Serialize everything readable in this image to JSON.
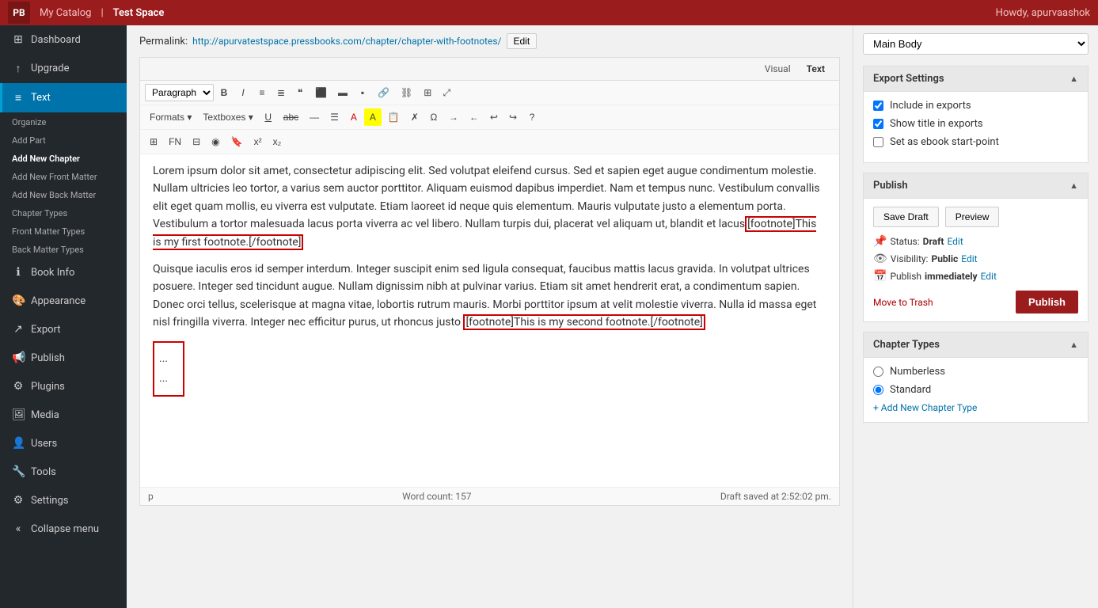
{
  "topbar": {
    "logo": "PB",
    "catalog_label": "My Catalog",
    "testspace_label": "Test Space",
    "howdy": "Howdy, apurvaashok"
  },
  "sidebar": {
    "items": [
      {
        "id": "dashboard",
        "label": "Dashboard",
        "icon": "⊞"
      },
      {
        "id": "upgrade",
        "label": "Upgrade",
        "icon": "↑"
      },
      {
        "id": "text",
        "label": "Text",
        "icon": "≡",
        "active": true
      },
      {
        "id": "organize",
        "label": "Organize",
        "icon": ""
      },
      {
        "id": "add-part",
        "label": "Add Part",
        "icon": ""
      },
      {
        "id": "add-new-chapter",
        "label": "Add New Chapter",
        "icon": ""
      },
      {
        "id": "add-front-matter",
        "label": "Add New Front Matter",
        "icon": ""
      },
      {
        "id": "add-back-matter",
        "label": "Add New Back Matter",
        "icon": ""
      },
      {
        "id": "chapter-types",
        "label": "Chapter Types",
        "icon": ""
      },
      {
        "id": "front-matter-types",
        "label": "Front Matter Types",
        "icon": ""
      },
      {
        "id": "back-matter-types",
        "label": "Back Matter Types",
        "icon": ""
      },
      {
        "id": "book-info",
        "label": "Book Info",
        "icon": "ℹ"
      },
      {
        "id": "appearance",
        "label": "Appearance",
        "icon": "🎨"
      },
      {
        "id": "export",
        "label": "Export",
        "icon": "↗"
      },
      {
        "id": "publish",
        "label": "Publish",
        "icon": "📢"
      },
      {
        "id": "plugins",
        "label": "Plugins",
        "icon": "⚙"
      },
      {
        "id": "media",
        "label": "Media",
        "icon": "🖼"
      },
      {
        "id": "users",
        "label": "Users",
        "icon": "👤"
      },
      {
        "id": "tools",
        "label": "Tools",
        "icon": "🔧"
      },
      {
        "id": "settings",
        "label": "Settings",
        "icon": "⚙"
      },
      {
        "id": "collapse",
        "label": "Collapse menu",
        "icon": "«"
      }
    ]
  },
  "editor": {
    "permalink_label": "Permalink:",
    "permalink_url": "http://apurvatestspace.pressbooks.com/chapter/chapter-with-footnotes/",
    "permalink_edit": "Edit",
    "tab_visual": "Visual",
    "tab_text": "Text",
    "toolbar": {
      "paragraph_select": "Paragraph",
      "formats_label": "Formats",
      "textboxes_label": "Textboxes",
      "fn_label": "FN"
    },
    "content": {
      "paragraph1": "Lorem ipsum dolor sit amet, consectetur adipiscing elit. Sed volutpat eleifend cursus. Sed et sapien eget augue condimentum molestie. Nullam ultricies leo tortor, a varius sem auctor porttitor. Aliquam euismod dapibus imperdiet. Nam et tempus nunc. Vestibulum convallis elit eget quam mollis, eu viverra est vulputate. Etiam laoreet id neque quis elementum. Mauris vulputate justo a elementum porta. Vestibulum a tortor malesuada lacus porta viverra ac vel libero. Nullam turpis dui, placerat vel aliquam ut, blandit et lacus",
      "footnote1": "[footnote]This is my first footnote.[/footnote]",
      "paragraph2": "Quisque iaculis eros id semper interdum. Integer suscipit enim sed ligula consequat, faucibus mattis lacus gravida. In volutpat ultrices posuere. Integer sed tincidunt augue. Nullam dignissim nibh at pulvinar varius. Etiam sit amet hendrerit erat, a condimentum sapien. Donec orci tellus, scelerisque at magna vitae, lobortis rutrum mauris. Morbi porttitor ipsum at velit molestie viverra. Nulla id massa eget nisl fringilla viverra. Integer nec efficitur purus, ut rhoncus justo",
      "footnote2": "[footnote]This is my second footnote.[/footnote]",
      "tag_p": "p",
      "word_count_label": "Word count:",
      "word_count": "157",
      "draft_saved": "Draft saved at 2:52:02 pm."
    }
  },
  "right_sidebar": {
    "main_body_select": "Main Body",
    "export_settings": {
      "title": "Export Settings",
      "include_in_exports_label": "Include in exports",
      "include_checked": true,
      "show_title_label": "Show title in exports",
      "show_title_checked": true,
      "set_ebook_label": "Set as ebook start-point",
      "set_ebook_checked": false
    },
    "publish": {
      "title": "Publish",
      "save_draft": "Save Draft",
      "preview": "Preview",
      "status_label": "Status:",
      "status_value": "Draft",
      "status_edit": "Edit",
      "visibility_label": "Visibility:",
      "visibility_value": "Public",
      "visibility_edit": "Edit",
      "publish_label": "Publish",
      "publish_time": "immediately",
      "publish_edit": "Edit",
      "move_to_trash": "Move to Trash",
      "publish_btn": "Publish"
    },
    "chapter_types": {
      "title": "Chapter Types",
      "numberless": "Numberless",
      "standard": "Standard",
      "add_new": "+ Add New Chapter Type"
    }
  }
}
